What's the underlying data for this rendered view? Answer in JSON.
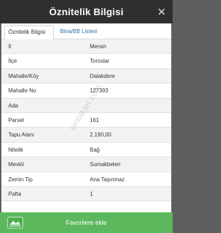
{
  "header": {
    "title": "Öznitelik Bilgisi"
  },
  "tabs": [
    {
      "label": "Öznitelik Bilgisi",
      "active": true
    },
    {
      "label": "Bina/BB Listesi",
      "active": false
    }
  ],
  "rows": [
    {
      "key": "İl",
      "value": "Mersin"
    },
    {
      "key": "İlçe",
      "value": "Toroslar"
    },
    {
      "key": "Mahalle/Köy",
      "value": "Dalakdere"
    },
    {
      "key": "Mahalle No",
      "value": "127393"
    },
    {
      "key": "Ada",
      "value": ""
    },
    {
      "key": "Parsel",
      "value": "161"
    },
    {
      "key": "Tapu Alanı",
      "value": "2.190,00"
    },
    {
      "key": "Nitelik",
      "value": "Bağ"
    },
    {
      "key": "Mevkii",
      "value": "Sumakbelen"
    },
    {
      "key": "Zemin Tip",
      "value": "Ana Taşınmaz"
    },
    {
      "key": "Pafta",
      "value": "1"
    }
  ],
  "watermark": "emlakjet.com",
  "footer": {
    "button_label": "Favorilere ekle"
  },
  "icons": {
    "close": "close-icon",
    "logo": "brand-logo-icon"
  },
  "colors": {
    "header_bg": "#2f2f2f",
    "footer_bg": "#5cb85c",
    "tab_link": "#2e6ea8"
  }
}
